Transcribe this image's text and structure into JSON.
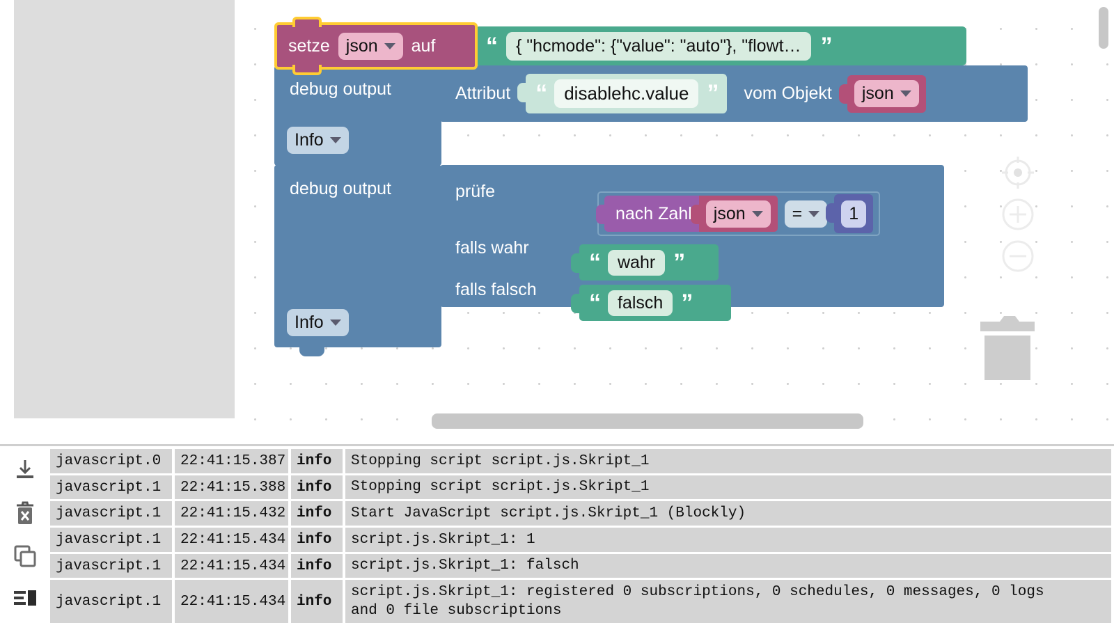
{
  "editor": {
    "toolbox_flyout": "",
    "zoom_controls": [
      {
        "name": "center-on-blocks",
        "icon": "target-icon"
      },
      {
        "name": "zoom-in",
        "icon": "plus-circle-icon"
      },
      {
        "name": "zoom-out",
        "icon": "minus-circle-icon"
      }
    ],
    "trash_icon": "trash-can-icon",
    "scrollbars": {
      "vertical": "vertical-scrollbar",
      "horizontal": "horizontal-scrollbar"
    }
  },
  "blocks": {
    "set_variable": {
      "keyword": "setze",
      "variable": "json",
      "suffix": "auf",
      "selected": true,
      "value_string": "{    \"hcmode\": {\"value\": \"auto\"},    \"flowt…"
    },
    "debug_output_1": {
      "label": "debug output",
      "severity": "Info",
      "attribute_block": {
        "label": "Attribut",
        "attribute": "disablehc.value",
        "of_label": "vom Objekt",
        "object": "json"
      }
    },
    "debug_output_2": {
      "label": "debug output",
      "severity": "Info",
      "test_block": {
        "test_label": "prüfe",
        "if_true_label": "falls wahr",
        "if_false_label": "falls falsch",
        "true_value": "wahr",
        "false_value": "falsch",
        "condition": {
          "convert_label": "nach Zahl",
          "variable": "json",
          "operator": "=",
          "number": "1"
        }
      }
    }
  },
  "log": {
    "tools": [
      {
        "name": "download-log-icon",
        "glyph": "download"
      },
      {
        "name": "clear-log-icon",
        "glyph": "trash-x"
      },
      {
        "name": "copy-log-icon",
        "glyph": "copy"
      },
      {
        "name": "log-layout-icon",
        "glyph": "list-panel"
      }
    ],
    "rows": [
      {
        "source": "javascript.0",
        "time": "22:41:15.387",
        "level": "info",
        "message": "Stopping script script.js.Skript_1"
      },
      {
        "source": "javascript.1",
        "time": "22:41:15.388",
        "level": "info",
        "message": "Stopping script script.js.Skript_1"
      },
      {
        "source": "javascript.1",
        "time": "22:41:15.432",
        "level": "info",
        "message": "Start JavaScript script.js.Skript_1 (Blockly)"
      },
      {
        "source": "javascript.1",
        "time": "22:41:15.434",
        "level": "info",
        "message": "script.js.Skript_1: 1"
      },
      {
        "source": "javascript.1",
        "time": "22:41:15.434",
        "level": "info",
        "message": "script.js.Skript_1: falsch"
      },
      {
        "source": "javascript.1",
        "time": "22:41:15.434",
        "level": "info",
        "message": "script.js.Skript_1: registered 0 subscriptions, 0 schedules, 0 messages, 0 logs\nand 0 file subscriptions"
      }
    ]
  },
  "colors": {
    "variable_block": "#a8527d",
    "text_block": "#4aa98d",
    "debug_block": "#5b85ad",
    "convert_block": "#9a5cab",
    "math_block": "#5c63aa",
    "selection_highlight": "#ffcc33",
    "log_cell": "#d4d4d4"
  }
}
